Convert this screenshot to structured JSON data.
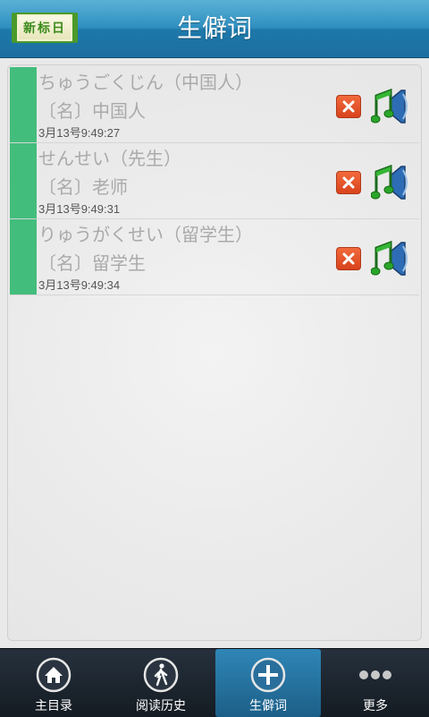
{
  "header": {
    "logo_text": "新标日",
    "title": "生僻词"
  },
  "words": [
    {
      "kana": "ちゅうごくじん（中国人）",
      "meaning": "〔名〕中国人",
      "time": "3月13号9:49:27"
    },
    {
      "kana": "せんせい（先生）",
      "meaning": "〔名〕老师",
      "time": "3月13号9:49:31"
    },
    {
      "kana": "りゅうがくせい（留学生）",
      "meaning": "〔名〕留学生",
      "time": "3月13号9:49:34"
    }
  ],
  "nav": {
    "items": [
      {
        "label": "主目录",
        "icon": "home-icon",
        "active": false
      },
      {
        "label": "阅读历史",
        "icon": "walking-person-icon",
        "active": false
      },
      {
        "label": "生僻词",
        "icon": "plus-icon",
        "active": true
      },
      {
        "label": "更多",
        "icon": "more-dots-icon",
        "active": false
      }
    ]
  },
  "colors": {
    "accent_bar": "#43bd7c",
    "header_blue": "#2f8fbf",
    "active_tab": "#2f86b6",
    "delete_red": "#e0532a"
  }
}
